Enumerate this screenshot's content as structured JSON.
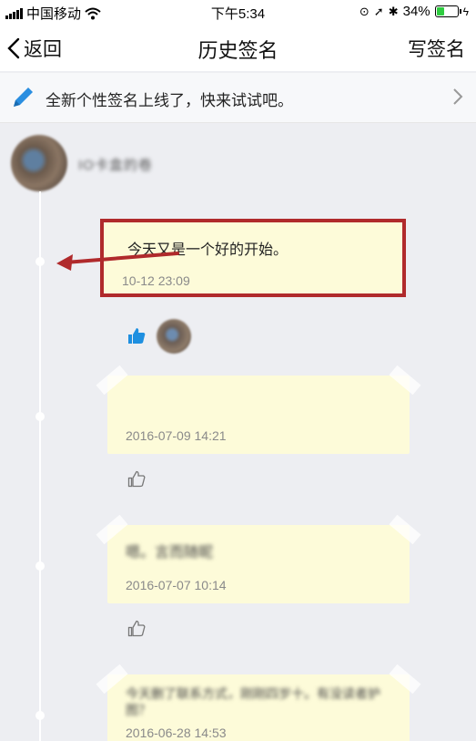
{
  "status_bar": {
    "carrier": "中国移动",
    "time": "下午5:34",
    "battery": "34%",
    "battery_level": 0.34
  },
  "nav": {
    "back_label": "返回",
    "title": "历史签名",
    "write_label": "写签名"
  },
  "notice": {
    "text": "全新个性签名上线了，快来试试吧。"
  },
  "profile": {
    "username": "IO卡盒的卷"
  },
  "signatures": [
    {
      "text": "今天又是一个好的开始。",
      "date": "10-12 23:09"
    },
    {
      "text": "",
      "date": "2016-07-09 14:21"
    },
    {
      "text": "嗯。言而随昵",
      "date": "2016-07-07 10:14"
    },
    {
      "text": "今天删了联系方式，刚刚四岁十。有没读者护图？",
      "date": "2016-06-28 14:53"
    }
  ],
  "colors": {
    "card_bg": "#fdfbd9",
    "highlight": "#b02a2c",
    "like_active": "#1e8fe0",
    "page_bg": "#edeef2"
  }
}
